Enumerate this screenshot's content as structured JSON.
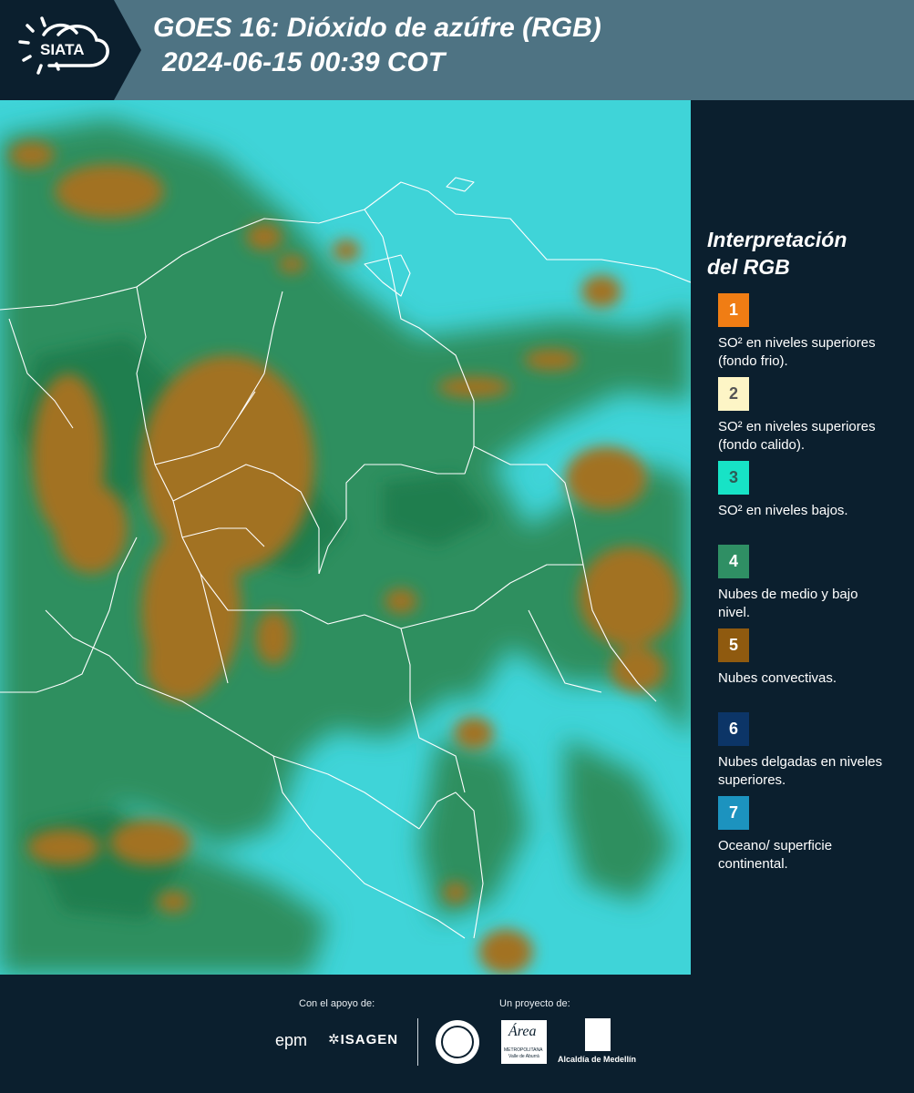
{
  "header": {
    "logo_text": "SIATA",
    "title_line1": "GOES 16: Dióxido de azúfre (RGB)",
    "title_line2": "2024-06-15 00:39 COT"
  },
  "legend": {
    "title_line1": "Interpretación",
    "title_line2": "del RGB",
    "items": [
      {
        "number": "1",
        "color": "#f07d14",
        "text_color": "#ffffff",
        "description": "SO² en niveles superiores (fondo frio)."
      },
      {
        "number": "2",
        "color": "#fdf5c6",
        "text_color": "#555555",
        "description": "SO² en niveles superiores (fondo calido)."
      },
      {
        "number": "3",
        "color": "#17e3c6",
        "text_color": "#2d5b55",
        "description": "SO² en niveles bajos."
      },
      {
        "number": "4",
        "color": "#2f8f64",
        "text_color": "#ffffff",
        "description": "Nubes de medio y bajo nivel."
      },
      {
        "number": "5",
        "color": "#8f5a0f",
        "text_color": "#ffffff",
        "description": "Nubes convectivas."
      },
      {
        "number": "6",
        "color": "#0c3567",
        "text_color": "#ffffff",
        "description": "Nubes delgadas en niveles superiores."
      },
      {
        "number": "7",
        "color": "#1c93bf",
        "text_color": "#ffffff",
        "description": "Oceano/ superficie continental."
      }
    ]
  },
  "footer": {
    "support_label": "Con el apoyo de:",
    "project_label": "Un proyecto de:",
    "sponsors": [
      "epm",
      "ISAGEN"
    ],
    "partners": [
      "Área Metropolitana Valle de Aburrá",
      "Alcaldía de Medellín"
    ],
    "area_logo_text": "Área",
    "area_logo_sub1": "METROPOLITANA",
    "area_logo_sub2": "Valle de Aburrá",
    "alcaldia_text": "Alcaldía de Medellín"
  }
}
